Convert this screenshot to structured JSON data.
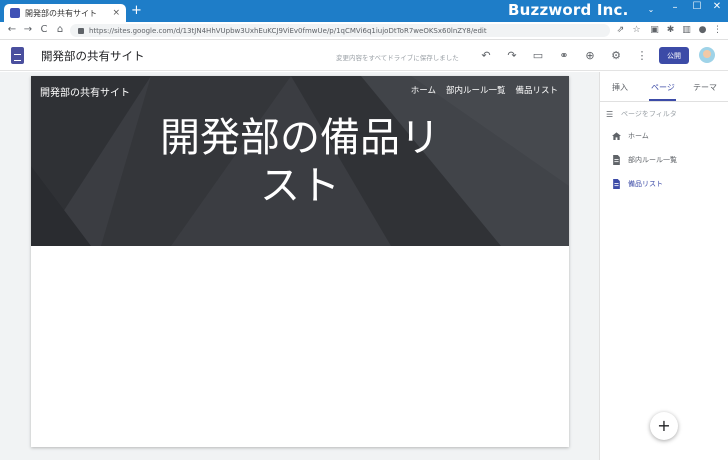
{
  "browser": {
    "tab_title": "開発部の共有サイト",
    "tab_close": "×",
    "new_tab": "+",
    "watermark": "Buzzword Inc.",
    "url": "https://sites.google.com/d/13tJN4HhVUpbw3UxhEuKCJ9ViEv0fmwUe/p/1qCMVi6q1iujoDtToR7weOKSx60lnZY8/edit",
    "controls": {
      "menu": "⌄",
      "minimize": "–",
      "maximize": "☐",
      "close": "✕"
    },
    "nav": {
      "back": "←",
      "forward": "→",
      "reload": "C",
      "home": "⌂"
    }
  },
  "appbar": {
    "title": "開発部の共有サイト",
    "save_status": "変更内容をすべてドライブに保存しました",
    "publish_label": "公開"
  },
  "site": {
    "name": "開発部の共有サイト",
    "nav": [
      "ホーム",
      "部内ルール一覧",
      "備品リスト"
    ],
    "heading": "開発部の備品リスト"
  },
  "panel": {
    "tabs": [
      "挿入",
      "ページ",
      "テーマ"
    ],
    "active_tab": "ページ",
    "filter_placeholder": "ページをフィルタ",
    "pages": [
      {
        "label": "ホーム",
        "icon": "home-icon"
      },
      {
        "label": "部内ルール一覧",
        "icon": "page-icon"
      },
      {
        "label": "備品リスト",
        "icon": "page-icon",
        "active": true
      }
    ],
    "fab": "+"
  },
  "colors": {
    "titlebar": "#1e7dc8",
    "accent": "#3c4ba7",
    "banner": "#37393d"
  }
}
